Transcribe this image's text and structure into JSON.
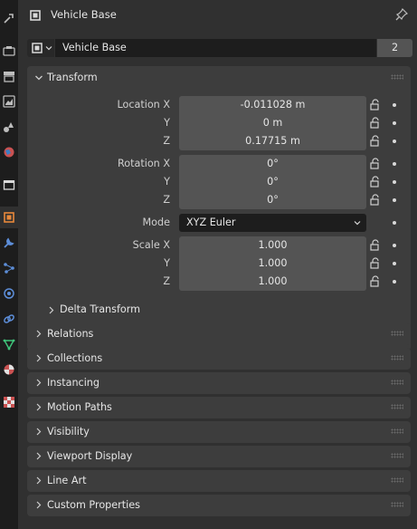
{
  "header": {
    "title": "Vehicle Base"
  },
  "datablock": {
    "name": "Vehicle Base",
    "users": "2"
  },
  "transform": {
    "title": "Transform",
    "location": {
      "label": "Location X",
      "x": "-0.011028 m",
      "y_label": "Y",
      "y": "0 m",
      "z_label": "Z",
      "z": "0.17715 m"
    },
    "rotation": {
      "label": "Rotation X",
      "x": "0°",
      "y_label": "Y",
      "y": "0°",
      "z_label": "Z",
      "z": "0°"
    },
    "mode": {
      "label": "Mode",
      "value": "XYZ Euler"
    },
    "scale": {
      "label": "Scale X",
      "x": "1.000",
      "y_label": "Y",
      "y": "1.000",
      "z_label": "Z",
      "z": "1.000"
    },
    "delta": "Delta Transform"
  },
  "panels": [
    "Relations",
    "Collections",
    "Instancing",
    "Motion Paths",
    "Visibility",
    "Viewport Display",
    "Line Art",
    "Custom Properties"
  ],
  "tabs": [
    "tool-icon",
    "render-icon",
    "output-icon",
    "view-layer-icon",
    "scene-icon",
    "world-icon",
    "collection-icon",
    "object-icon",
    "modifier-icon",
    "particles-icon",
    "physics-icon",
    "constraints-icon",
    "data-icon",
    "material-icon",
    "texture-icon"
  ],
  "colors": {
    "accent": "#e8883a",
    "panel": "#3d3d3d",
    "field": "#545454"
  }
}
